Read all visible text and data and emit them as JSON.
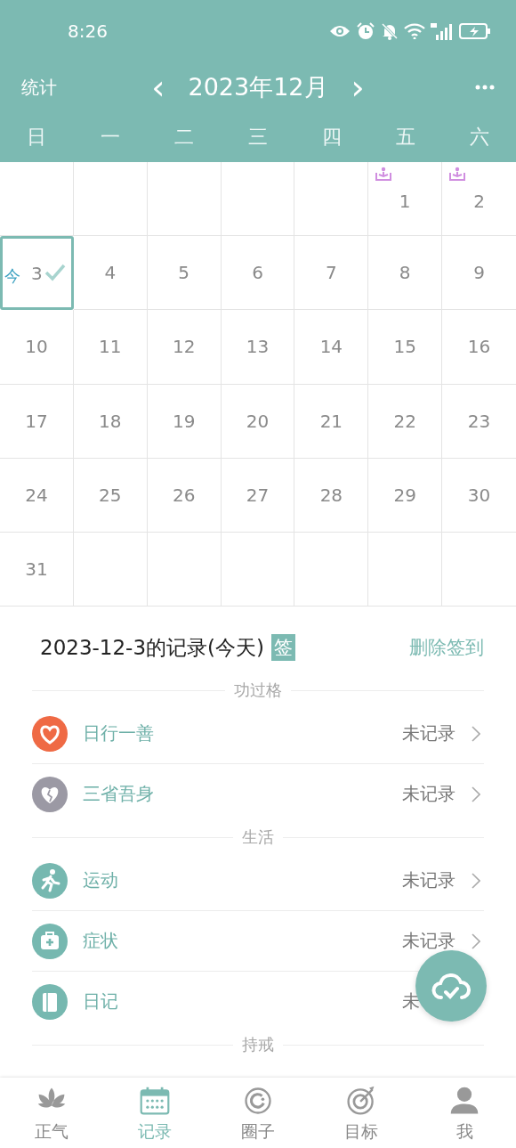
{
  "status_bar": {
    "time": "8:26"
  },
  "header": {
    "left": "统计",
    "month": "2023年12月",
    "prev": "‹",
    "next": "›"
  },
  "weekdays": [
    "日",
    "一",
    "二",
    "三",
    "四",
    "五",
    "六"
  ],
  "calendar": [
    {
      "kind": "empty"
    },
    {
      "kind": "empty"
    },
    {
      "kind": "empty"
    },
    {
      "kind": "empty"
    },
    {
      "kind": "empty"
    },
    {
      "kind": "day",
      "day": "1",
      "marked": true,
      "selected": false,
      "checked": false
    },
    {
      "kind": "day",
      "day": "2",
      "marked": true,
      "selected": false,
      "checked": false
    },
    {
      "kind": "day",
      "day": "3",
      "marked": false,
      "selected": true,
      "checked": true,
      "today": "今"
    },
    {
      "kind": "day",
      "day": "4",
      "marked": false,
      "selected": false,
      "checked": false
    },
    {
      "kind": "day",
      "day": "5",
      "marked": false,
      "selected": false,
      "checked": false
    },
    {
      "kind": "day",
      "day": "6",
      "marked": false,
      "selected": false,
      "checked": false
    },
    {
      "kind": "day",
      "day": "7",
      "marked": false,
      "selected": false,
      "checked": false
    },
    {
      "kind": "day",
      "day": "8",
      "marked": false,
      "selected": false,
      "checked": false
    },
    {
      "kind": "day",
      "day": "9",
      "marked": false,
      "selected": false,
      "checked": false
    },
    {
      "kind": "day",
      "day": "10",
      "marked": false,
      "selected": false,
      "checked": false
    },
    {
      "kind": "day",
      "day": "11",
      "marked": false,
      "selected": false,
      "checked": false
    },
    {
      "kind": "day",
      "day": "12",
      "marked": false,
      "selected": false,
      "checked": false
    },
    {
      "kind": "day",
      "day": "13",
      "marked": false,
      "selected": false,
      "checked": false
    },
    {
      "kind": "day",
      "day": "14",
      "marked": false,
      "selected": false,
      "checked": false
    },
    {
      "kind": "day",
      "day": "15",
      "marked": false,
      "selected": false,
      "checked": false
    },
    {
      "kind": "day",
      "day": "16",
      "marked": false,
      "selected": false,
      "checked": false
    },
    {
      "kind": "day",
      "day": "17",
      "marked": false,
      "selected": false,
      "checked": false
    },
    {
      "kind": "day",
      "day": "18",
      "marked": false,
      "selected": false,
      "checked": false
    },
    {
      "kind": "day",
      "day": "19",
      "marked": false,
      "selected": false,
      "checked": false
    },
    {
      "kind": "day",
      "day": "20",
      "marked": false,
      "selected": false,
      "checked": false
    },
    {
      "kind": "day",
      "day": "21",
      "marked": false,
      "selected": false,
      "checked": false
    },
    {
      "kind": "day",
      "day": "22",
      "marked": false,
      "selected": false,
      "checked": false
    },
    {
      "kind": "day",
      "day": "23",
      "marked": false,
      "selected": false,
      "checked": false
    },
    {
      "kind": "day",
      "day": "24",
      "marked": false,
      "selected": false,
      "checked": false
    },
    {
      "kind": "day",
      "day": "25",
      "marked": false,
      "selected": false,
      "checked": false
    },
    {
      "kind": "day",
      "day": "26",
      "marked": false,
      "selected": false,
      "checked": false
    },
    {
      "kind": "day",
      "day": "27",
      "marked": false,
      "selected": false,
      "checked": false
    },
    {
      "kind": "day",
      "day": "28",
      "marked": false,
      "selected": false,
      "checked": false
    },
    {
      "kind": "day",
      "day": "29",
      "marked": false,
      "selected": false,
      "checked": false
    },
    {
      "kind": "day",
      "day": "30",
      "marked": false,
      "selected": false,
      "checked": false
    },
    {
      "kind": "day",
      "day": "31",
      "marked": false,
      "selected": false,
      "checked": false
    },
    {
      "kind": "empty"
    },
    {
      "kind": "empty"
    },
    {
      "kind": "empty"
    },
    {
      "kind": "empty"
    },
    {
      "kind": "empty"
    },
    {
      "kind": "empty"
    }
  ],
  "record": {
    "title": "2023-12-3的记录(今天)",
    "badge": "签",
    "action": "删除签到",
    "sections": [
      {
        "title": "功过格",
        "items": [
          {
            "kind": "heart",
            "color": "#ef6a45",
            "label": "日行一善",
            "status": "未记录"
          },
          {
            "kind": "brokenheart",
            "color": "#9b99a4",
            "label": "三省吾身",
            "status": "未记录"
          }
        ]
      },
      {
        "title": "生活",
        "items": [
          {
            "kind": "runner",
            "color": "#76b8b0",
            "label": "运动",
            "status": "未记录"
          },
          {
            "kind": "medkit",
            "color": "#76b8b0",
            "label": "症状",
            "status": "未记录"
          },
          {
            "kind": "notebook",
            "color": "#76b8b0",
            "label": "日记",
            "status": "未",
            "chevron": false
          }
        ]
      },
      {
        "title": "持戒"
      }
    ]
  },
  "tabs": [
    {
      "kind": "lotus",
      "label": "正气",
      "selected": false
    },
    {
      "kind": "calendar",
      "label": "记录",
      "selected": true
    },
    {
      "kind": "ring",
      "label": "圈子",
      "selected": false
    },
    {
      "kind": "target",
      "label": "目标",
      "selected": false
    },
    {
      "kind": "person",
      "label": "我",
      "selected": false
    }
  ]
}
